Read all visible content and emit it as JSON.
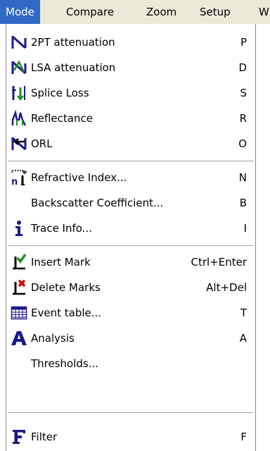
{
  "menubar": {
    "items": [
      {
        "label": "Mode"
      },
      {
        "label": "Compare"
      },
      {
        "label": "Zoom"
      },
      {
        "label": "Setup"
      },
      {
        "label": "W"
      }
    ]
  },
  "dropdown": {
    "items": [
      {
        "label": "2PT attenuation",
        "shortcut": "P",
        "icon": "2pt-attenuation-icon"
      },
      {
        "label": "LSA attenuation",
        "shortcut": "D",
        "icon": "lsa-attenuation-icon"
      },
      {
        "label": "Splice Loss",
        "shortcut": "S",
        "icon": "splice-loss-icon"
      },
      {
        "label": "Reflectance",
        "shortcut": "R",
        "icon": "reflectance-icon"
      },
      {
        "label": "ORL",
        "shortcut": "O",
        "icon": "orl-icon"
      },
      {
        "label": "Refractive Index...",
        "shortcut": "N",
        "icon": "refractive-index-icon"
      },
      {
        "label": "Backscatter Coefficient...",
        "shortcut": "B",
        "icon": ""
      },
      {
        "label": "Trace Info...",
        "shortcut": "I",
        "icon": "info-icon"
      },
      {
        "label": "Insert Mark",
        "shortcut": "Ctrl+Enter",
        "icon": "insert-mark-icon"
      },
      {
        "label": "Delete Marks",
        "shortcut": "Alt+Del",
        "icon": "delete-marks-icon"
      },
      {
        "label": "Event table...",
        "shortcut": "T",
        "icon": "event-table-icon"
      },
      {
        "label": "Analysis",
        "shortcut": "A",
        "icon": "analysis-icon"
      },
      {
        "label": "Thresholds...",
        "shortcut": "",
        "icon": ""
      },
      {
        "label": "Filter",
        "shortcut": "F",
        "icon": "filter-icon"
      }
    ]
  },
  "colors": {
    "menu_highlight": "#316ac5",
    "menubar_bg": "#ece9d8",
    "icon_navy": "#1a1a8c",
    "icon_green": "#1f8f1f",
    "icon_red": "#d40000"
  }
}
